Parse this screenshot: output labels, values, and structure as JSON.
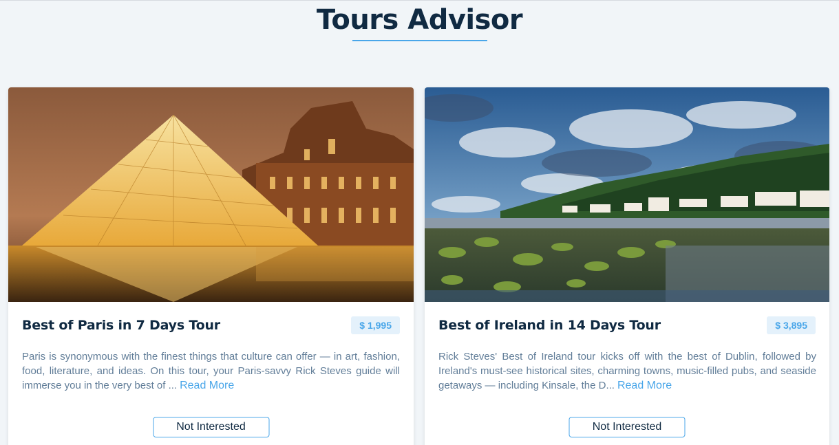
{
  "header": {
    "title": "Tours Advisor"
  },
  "tours": [
    {
      "name": "Best of Paris in 7 Days Tour",
      "price": "$ 1,995",
      "info": "Paris is synonymous with the finest things that culture can offer — in art, fashion, food, literature, and ideas. On this tour, your Paris-savvy Rick Steves guide will immerse you in the very best of ...",
      "read_more_label": "Read More",
      "not_interested_label": "Not Interested",
      "image_subject": "louvre-pyramid-night"
    },
    {
      "name": "Best of Ireland in 14 Days Tour",
      "price": "$ 3,895",
      "info": "Rick Steves' Best of Ireland tour kicks off with the best of Dublin, followed by Ireland's must-see historical sites, charming towns, music-filled pubs, and seaside getaways — including Kinsale, the D...",
      "read_more_label": "Read More",
      "not_interested_label": "Not Interested",
      "image_subject": "irish-coast-village"
    }
  ],
  "colors": {
    "background": "#f1f5f8",
    "title": "#102a42",
    "accent": "#49a6e9",
    "price_bg": "#e4f1fb",
    "text": "#617d98"
  }
}
